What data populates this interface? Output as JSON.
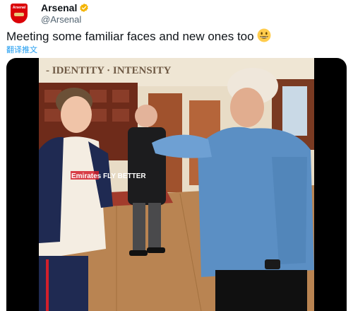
{
  "account": {
    "display_name": "Arsenal",
    "handle": "@Arsenal",
    "verified": true,
    "avatar_icon": "arsenal-crest-icon",
    "crest_text": "Arsenal"
  },
  "tweet": {
    "text": "Meeting some familiar faces and new ones too",
    "emoji": "grinning-face-emoji",
    "translate_label": "翻译推文"
  },
  "media": {
    "wall_text": "- IDENTITY · INTENSITY",
    "shirt_text": "Emirates FLY BETTER"
  },
  "colors": {
    "accent": "#1d9bf0",
    "verified_badge": "#f4b400",
    "arsenal_red": "#db0007"
  }
}
